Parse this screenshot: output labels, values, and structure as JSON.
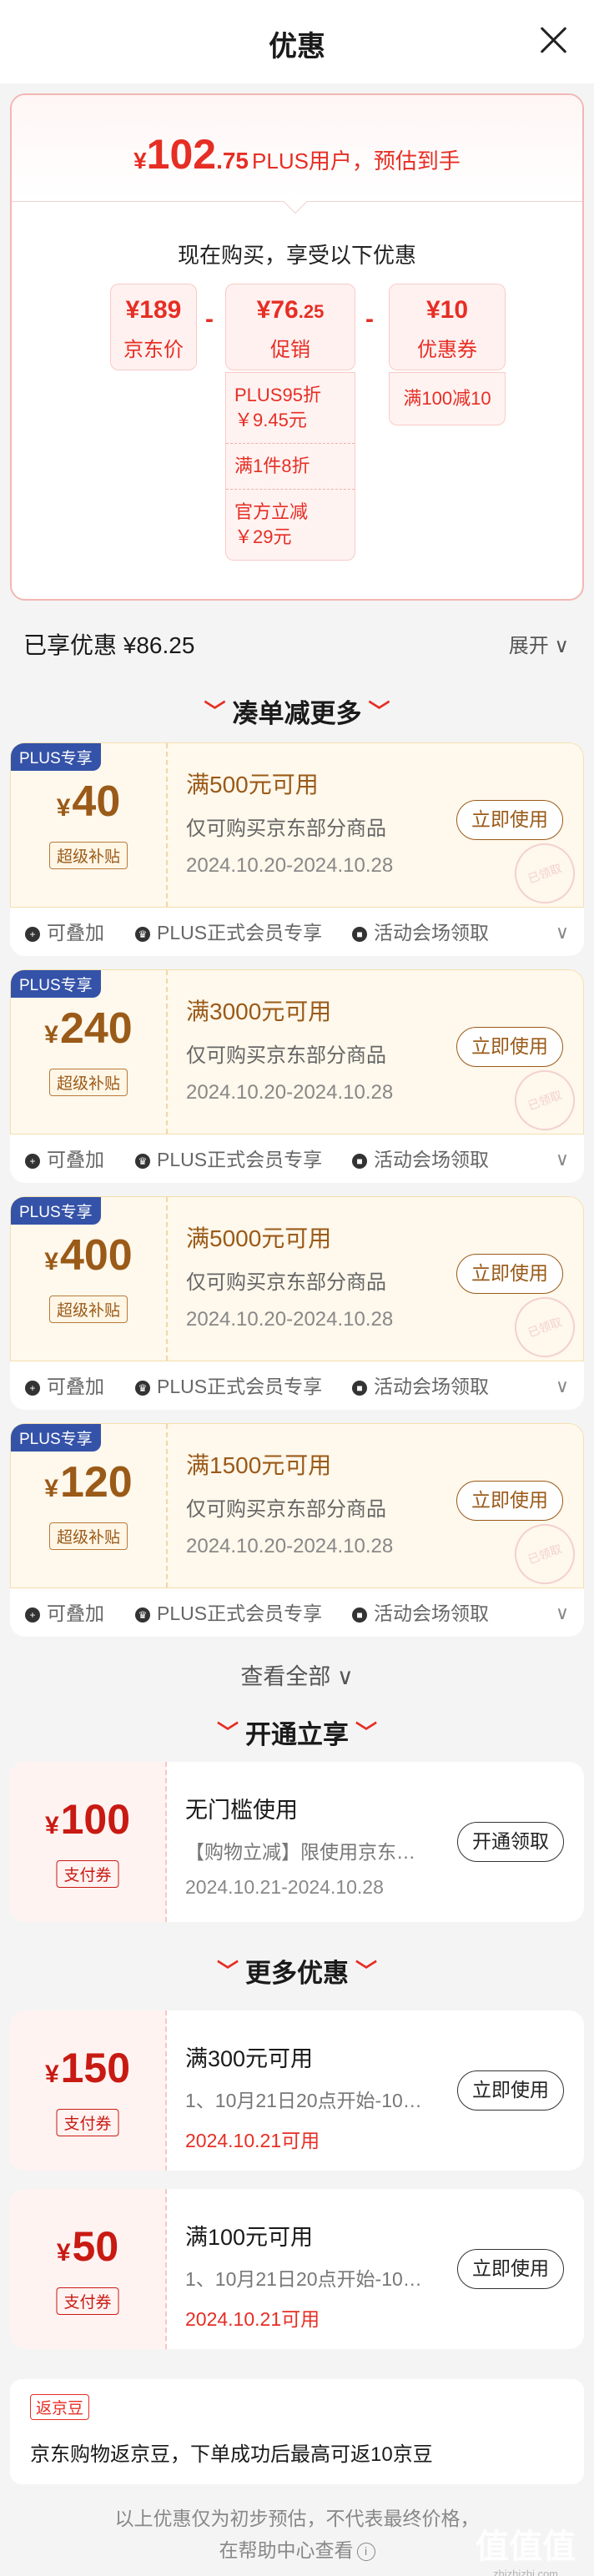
{
  "header": {
    "title": "优惠"
  },
  "summary": {
    "currency": "¥",
    "price_int": "102",
    "price_dec": ".75",
    "price_note": "PLUS用户，预估到手",
    "subtitle": "现在购买，享受以下优惠",
    "jd_price": {
      "amount": "¥189",
      "label": "京东价"
    },
    "promo": {
      "amount": "¥76",
      "amount_dec": ".25",
      "label": "促销"
    },
    "coupon": {
      "amount": "¥10",
      "label": "优惠券"
    },
    "minus_1": "-",
    "minus_2": "-",
    "promo_items": [
      {
        "line1": "PLUS95折",
        "line2": "￥9.45元"
      },
      {
        "line1": "满1件8折",
        "line2": ""
      },
      {
        "line1": "官方立减",
        "line2": "￥29元"
      }
    ],
    "coupon_items": [
      "满100减10"
    ]
  },
  "enjoyed": {
    "text": "已享优惠 ¥86.25",
    "expand": "展开 ∨"
  },
  "sections": {
    "stack": {
      "title": "凑单减更多",
      "deco": "﹀"
    },
    "open": {
      "title": "开通立享"
    },
    "more": {
      "title": "更多优惠"
    }
  },
  "coupons": [
    {
      "tag": "PLUS专享",
      "currency": "¥",
      "amount": "40",
      "badge": "超级补贴",
      "cond": "满500元可用",
      "scope": "仅可购买京东部分商品",
      "date": "2024.10.20-2024.10.28",
      "btn": "立即使用",
      "stamp": "已领取"
    },
    {
      "tag": "PLUS专享",
      "currency": "¥",
      "amount": "240",
      "badge": "超级补贴",
      "cond": "满3000元可用",
      "scope": "仅可购买京东部分商品",
      "date": "2024.10.20-2024.10.28",
      "btn": "立即使用",
      "stamp": "已领取"
    },
    {
      "tag": "PLUS专享",
      "currency": "¥",
      "amount": "400",
      "badge": "超级补贴",
      "cond": "满5000元可用",
      "scope": "仅可购买京东部分商品",
      "date": "2024.10.20-2024.10.28",
      "btn": "立即使用",
      "stamp": "已领取"
    },
    {
      "tag": "PLUS专享",
      "currency": "¥",
      "amount": "120",
      "badge": "超级补贴",
      "cond": "满1500元可用",
      "scope": "仅可购买京东部分商品",
      "date": "2024.10.20-2024.10.28",
      "btn": "立即使用",
      "stamp": "已领取"
    }
  ],
  "coupon_footer": {
    "stackable": "可叠加",
    "plus_only": "PLUS正式会员专享",
    "venue": "活动会场领取",
    "chevron": "∨",
    "icons": [
      "plus-circle-icon",
      "crown-icon",
      "gift-icon"
    ]
  },
  "view_all": "查看全部 ∨",
  "open_card": {
    "currency": "¥",
    "amount": "100",
    "badge": "支付券",
    "title": "无门槛使用",
    "desc": "【购物立减】限使用京东…",
    "date": "2024.10.21-2024.10.28",
    "btn": "开通领取"
  },
  "more_cards": [
    {
      "currency": "¥",
      "amount": "150",
      "badge": "支付券",
      "title": "满300元可用",
      "desc": "1、10月21日20点开始-10…",
      "date": "2024.10.21可用",
      "btn": "立即使用"
    },
    {
      "currency": "¥",
      "amount": "50",
      "badge": "支付券",
      "title": "满100元可用",
      "desc": "1、10月21日20点开始-10…",
      "date": "2024.10.21可用",
      "btn": "立即使用"
    }
  ],
  "jingdou": {
    "tag": "返京豆",
    "text": "京东购物返京豆，下单成功后最高可返10京豆"
  },
  "disclaimer": {
    "line1": "以上优惠仅为初步预估，不代表最终价格，",
    "line2": "在帮助中心查看"
  },
  "watermark": {
    "text": "值值值",
    "sub": "zhizhizhi.com"
  },
  "colors": {
    "accent": "#e62e24",
    "coupon_gold": "#9a5a18",
    "plus_blue": "#3452a8"
  }
}
